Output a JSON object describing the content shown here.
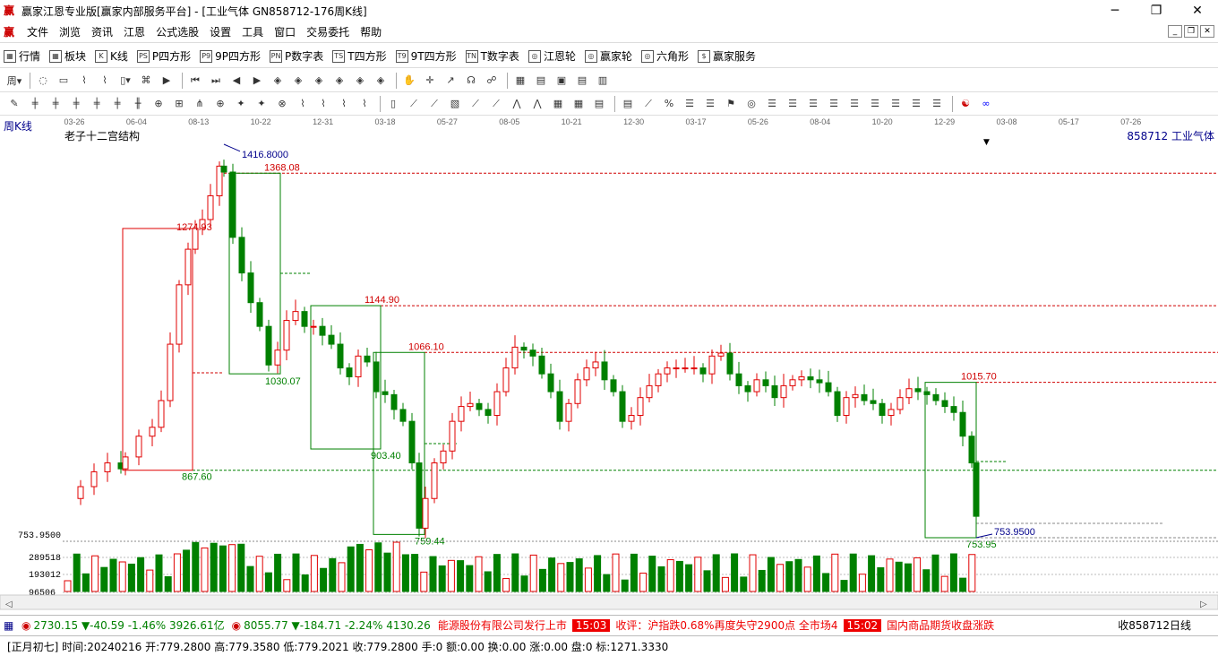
{
  "window": {
    "title": "赢家江恩专业版[赢家内部服务平台] - [工业气体  GN858712-176周K线]",
    "logo": "赢",
    "controls": [
      "─",
      "❐",
      "✕"
    ]
  },
  "menu": {
    "logo": "赢",
    "items": [
      "文件",
      "浏览",
      "资讯",
      "江恩",
      "公式选股",
      "设置",
      "工具",
      "窗口",
      "交易委托",
      "帮助"
    ]
  },
  "toolbar1": {
    "items": [
      {
        "icon": "grid-icon",
        "glyph": "▦",
        "label": "行情"
      },
      {
        "icon": "block-icon",
        "glyph": "▦",
        "label": "板块"
      },
      {
        "icon": "kline-icon",
        "glyph": "K",
        "label": "K线"
      },
      {
        "icon": "ps-icon",
        "glyph": "PS",
        "label": "P四方形"
      },
      {
        "icon": "p9-icon",
        "glyph": "P9",
        "label": "9P四方形"
      },
      {
        "icon": "pn-icon",
        "glyph": "PN",
        "label": "P数字表"
      },
      {
        "icon": "ts-icon",
        "glyph": "TS",
        "label": "T四方形"
      },
      {
        "icon": "t9-icon",
        "glyph": "T9",
        "label": "9T四方形"
      },
      {
        "icon": "tn-icon",
        "glyph": "TN",
        "label": "T数字表"
      },
      {
        "icon": "gann-wheel-icon",
        "glyph": "◎",
        "label": "江恩轮"
      },
      {
        "icon": "winner-wheel-icon",
        "glyph": "◎",
        "label": "赢家轮"
      },
      {
        "icon": "hexagon-icon",
        "glyph": "◎",
        "label": "六角形"
      },
      {
        "icon": "dollar-icon",
        "glyph": "$",
        "label": "赢家服务"
      }
    ]
  },
  "chart": {
    "period_label": "周K线",
    "indicator_name": "老子十二宫结构",
    "code_label": "858712  工业气体",
    "date_ticks": [
      "03-26",
      "06-04",
      "08-13",
      "10-22",
      "12-31",
      "03-18",
      "05-27",
      "08-05",
      "10-21",
      "12-30",
      "03-17",
      "05-26",
      "08-04",
      "10-20",
      "12-29",
      "03-08",
      "05-17",
      "07-26"
    ],
    "price_axis_label": "753.9500",
    "volume_ticks": [
      "289518",
      "193012",
      "96506"
    ],
    "annotations": {
      "high": "1416.8000",
      "low_right": "753.9500",
      "levels": [
        "1368.08",
        "1274.93",
        "1144.90",
        "1066.10",
        "1015.70",
        "1030.07",
        "903.40",
        "867.60",
        "759.44",
        "753.95"
      ]
    }
  },
  "taskbar": {
    "sh_index": "2730.15",
    "sh_change": "▼-40.59",
    "sh_pct": "-1.46%",
    "sh_amount": "3926.61亿",
    "sz_index": "8055.77",
    "sz_change": "▼-184.71",
    "sz_pct": "-2.24%",
    "sz_amount": "4130.26",
    "news1": "能源股份有限公司发行上市",
    "time1": "15:03",
    "news2": "收评：沪指跌0.68%再度失守2900点 全市场4",
    "time2": "15:02",
    "news3": "国内商品期货收盘涨跌",
    "right_label": "收858712日线"
  },
  "status": {
    "text": "[正月初七] 时间:20240216 开:779.2800 高:779.3580 低:779.2021 收:779.2800 手:0 额:0.00 换:0.00 涨:0.00 盘:0 标:1271.3330"
  },
  "colors": {
    "up": "#e00000",
    "down": "#008000",
    "box_red": "#e00000",
    "box_green": "#008000",
    "level_red": "#d00000",
    "accent_blue": "#00008b"
  }
}
